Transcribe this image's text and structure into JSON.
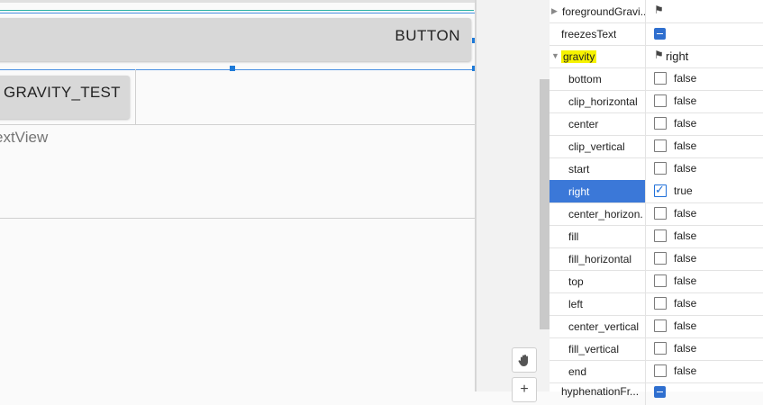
{
  "canvas": {
    "button_label": "BUTTON",
    "gravity_test_label": "GRAVITY_TEST",
    "textview_label": "extView"
  },
  "toolbar": {
    "pan_icon": "hand-icon",
    "zoom_icon": "plus-icon",
    "zoom_glyph": "+"
  },
  "properties": {
    "foreground_gravity": "foregroundGravi...",
    "freezes_text": "freezesText",
    "gravity": {
      "name": "gravity",
      "value": "right"
    },
    "flags": [
      {
        "name": "bottom",
        "value": "false",
        "checked": false
      },
      {
        "name": "clip_horizontal",
        "value": "false",
        "checked": false
      },
      {
        "name": "center",
        "value": "false",
        "checked": false
      },
      {
        "name": "clip_vertical",
        "value": "false",
        "checked": false
      },
      {
        "name": "start",
        "value": "false",
        "checked": false
      },
      {
        "name": "right",
        "value": "true",
        "checked": true
      },
      {
        "name": "center_horizon...",
        "value": "false",
        "checked": false
      },
      {
        "name": "fill",
        "value": "false",
        "checked": false
      },
      {
        "name": "fill_horizontal",
        "value": "false",
        "checked": false
      },
      {
        "name": "top",
        "value": "false",
        "checked": false
      },
      {
        "name": "left",
        "value": "false",
        "checked": false
      },
      {
        "name": "center_vertical",
        "value": "false",
        "checked": false
      },
      {
        "name": "fill_vertical",
        "value": "false",
        "checked": false
      },
      {
        "name": "end",
        "value": "false",
        "checked": false
      }
    ],
    "last_row_partial": "hyphenationFr..."
  },
  "colors": {
    "selection": "#3b78d8",
    "highlight": "#f6f200",
    "accent": "#1e7ad8"
  }
}
